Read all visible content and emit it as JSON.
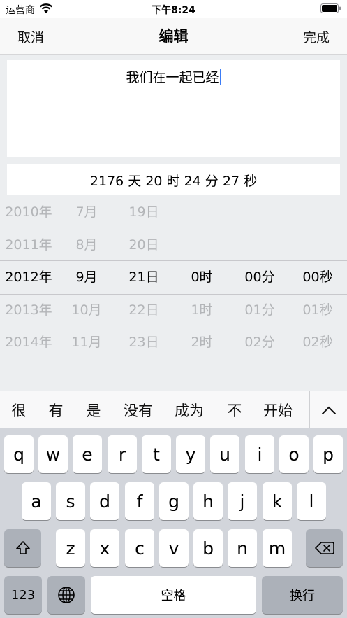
{
  "status_bar": {
    "carrier": "运营商",
    "time": "下午8:24"
  },
  "nav": {
    "cancel": "取消",
    "title": "编辑",
    "done": "完成"
  },
  "editor": {
    "text": "我们在一起已经"
  },
  "counter": {
    "text": "2176 天 20 时 24 分 27 秒"
  },
  "picker": {
    "years": [
      "2010年",
      "2011年",
      "2012年",
      "2013年",
      "2014年"
    ],
    "months": [
      "7月",
      "8月",
      "9月",
      "10月",
      "11月"
    ],
    "days": [
      "19日",
      "20日",
      "21日",
      "22日",
      "23日"
    ],
    "hours": [
      "",
      "",
      "0时",
      "1时",
      "2时"
    ],
    "minutes": [
      "",
      "",
      "00分",
      "01分",
      "02分"
    ],
    "seconds": [
      "",
      "",
      "00秒",
      "01秒",
      "02秒"
    ],
    "selected_index": 2
  },
  "suggestions": [
    "很",
    "有",
    "是",
    "没有",
    "成为",
    "不",
    "开始"
  ],
  "keyboard": {
    "row1": [
      "q",
      "w",
      "e",
      "r",
      "t",
      "y",
      "u",
      "i",
      "o",
      "p"
    ],
    "row2": [
      "a",
      "s",
      "d",
      "f",
      "g",
      "h",
      "j",
      "k",
      "l"
    ],
    "row3": [
      "z",
      "x",
      "c",
      "v",
      "b",
      "n",
      "m"
    ],
    "numbers_key": "123",
    "space_key": "空格",
    "return_key": "换行"
  },
  "colors": {
    "cursor": "#3b7cf6",
    "background": "#eceef0",
    "keyboard": "#d2d5db"
  }
}
